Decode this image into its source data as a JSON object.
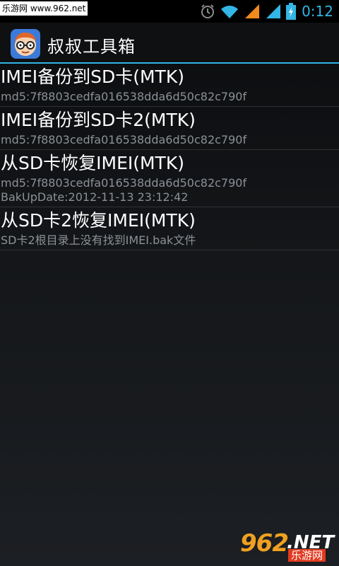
{
  "status_bar": {
    "watermark": "乐游网 www.962.net",
    "time": "0:12",
    "icons": [
      "alarm-icon",
      "wifi-icon",
      "signal-icon",
      "signal-icon",
      "battery-charging-icon"
    ],
    "accent": "#33b5e5"
  },
  "action_bar": {
    "app_icon": "app-face-icon",
    "title": "叔叔工具箱"
  },
  "list": {
    "items": [
      {
        "title": "IMEI备份到SD卡(MTK)",
        "subs": [
          "md5:7f8803cedfa016538dda6d50c82c790f"
        ]
      },
      {
        "title": "IMEI备份到SD卡2(MTK)",
        "subs": [
          "md5:7f8803cedfa016538dda6d50c82c790f"
        ]
      },
      {
        "title": "从SD卡恢复IMEI(MTK)",
        "subs": [
          "md5:7f8803cedfa016538dda6d50c82c790f",
          "BakUpDate:2012-11-13 23:12:42"
        ]
      },
      {
        "title": "从SD卡2恢复IMEI(MTK)",
        "subs": [
          "SD卡2根目录上没有找到IMEI.bak文件"
        ]
      }
    ]
  },
  "watermark_bottom": {
    "brand_number": "962",
    "brand_tld": ".NET",
    "brand_cn": "乐游网"
  }
}
